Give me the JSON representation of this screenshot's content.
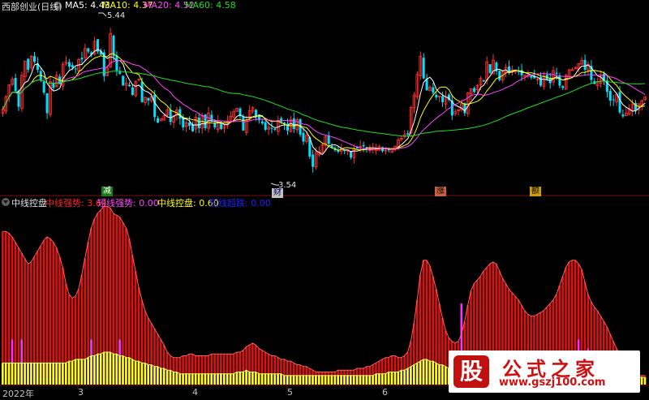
{
  "panel_top": {
    "title": "西部创业(日线)",
    "indicators": [
      {
        "label": "MA5: 4.43",
        "color": "#ffffff"
      },
      {
        "label": "MA10: 4.37",
        "color": "#ffff00"
      },
      {
        "label": "MA20: 4.52",
        "color": "#ff44ff"
      },
      {
        "label": "MA60: 4.58",
        "color": "#22dd22"
      }
    ],
    "high_label": "5.44",
    "low_label": "3.54",
    "markers": [
      {
        "text": "减",
        "bg": "#1a7a1a",
        "color": "#ffffff"
      },
      {
        "text": "财",
        "bg": "#c0c0c0",
        "color": "#000060"
      },
      {
        "text": "涨",
        "bg": "#c86040",
        "color": "#000000"
      },
      {
        "text": "额",
        "bg": "#d0a000",
        "color": "#000000"
      }
    ]
  },
  "panel_bottom": {
    "title": "中线控盘",
    "indicators": [
      {
        "label": "中线强势: 3.64",
        "color": "#ff2020"
      },
      {
        "label": "短线强势: 0.00",
        "color": "#ff44ff"
      },
      {
        "label": "中线控盘: 0.60",
        "color": "#ffff00"
      },
      {
        "label": "短线超跌: 0.00",
        "color": "#2020ff"
      }
    ]
  },
  "x_axis": {
    "labels": [
      "2022年",
      "3",
      "4",
      "5",
      "6"
    ]
  },
  "watermark": {
    "logo": "股",
    "name": "公式之家",
    "url": "www.gszj100.com"
  },
  "colors": {
    "up": "#ff3030",
    "down": "#00e0ff",
    "ma5": "#ffffff",
    "ma10": "#ffff00",
    "ma20": "#ff44ff",
    "ma60": "#22dd22",
    "bar_red": "#e01010",
    "bar_yellow": "#ffff20",
    "bar_magenta": "#ff30ff"
  },
  "chart_data": [
    {
      "type": "candlestick",
      "title": "西部创业(日线)",
      "series": [
        {
          "name": "MA5",
          "last": 4.43
        },
        {
          "name": "MA10",
          "last": 4.37
        },
        {
          "name": "MA20",
          "last": 4.52
        },
        {
          "name": "MA60",
          "last": 4.58
        }
      ],
      "close_approx": [
        4.36,
        4.52,
        4.67,
        4.74,
        4.59,
        4.39,
        4.79,
        4.97,
        4.86,
        5.03,
        4.96,
        4.86,
        4.73,
        4.57,
        4.31,
        4.71,
        4.63,
        4.79,
        4.68,
        4.93,
        4.96,
        4.9,
        4.89,
        4.87,
        4.99,
        4.99,
        5.13,
        5.09,
        5.05,
        5.22,
        5.09,
        5.05,
        4.78,
        4.88,
        5.32,
        5.03,
        4.85,
        4.81,
        4.66,
        4.69,
        4.65,
        4.54,
        4.71,
        4.74,
        4.45,
        4.51,
        4.47,
        4.52,
        4.26,
        4.19,
        4.24,
        4.28,
        4.35,
        4.2,
        4.28,
        4.35,
        4.24,
        4.13,
        4.19,
        4.15,
        4.08,
        4.26,
        4.12,
        4.28,
        4.12,
        4.31,
        4.21,
        4.13,
        4.21,
        4.11,
        4.17,
        4.21,
        4.27,
        4.33,
        4.37,
        4.27,
        4.09,
        4.22,
        4.34,
        4.38,
        4.27,
        4.22,
        4.18,
        4.1,
        4.13,
        4.12,
        4.1,
        4.22,
        4.2,
        4.17,
        4.09,
        4.23,
        4.11,
        4.23,
        4.04,
        3.95,
        4.03,
        3.76,
        3.63,
        3.81,
        3.82,
        3.91,
        4.01,
        3.92,
        3.87,
        3.84,
        3.82,
        3.87,
        3.83,
        3.85,
        3.75,
        3.86,
        3.86,
        3.89,
        3.89,
        3.86,
        3.86,
        3.86,
        3.87,
        3.89,
        3.83,
        3.84,
        3.84,
        3.86,
        3.89,
        3.97,
        3.99,
        4.04,
        4.04,
        4.38,
        4.54,
        4.8,
        5.03,
        4.75,
        4.6,
        4.64,
        4.57,
        4.51,
        4.53,
        4.45,
        4.52,
        4.48,
        4.28,
        4.33,
        4.35,
        4.43,
        4.31,
        4.57,
        4.62,
        4.58,
        4.66,
        4.75,
        4.71,
        4.96,
        4.82,
        4.98,
        4.84,
        4.73,
        4.85,
        4.89,
        4.82,
        4.86,
        4.84,
        4.84,
        4.79,
        4.79,
        4.79,
        4.76,
        4.75,
        4.74,
        4.66,
        4.78,
        4.74,
        4.69,
        4.85,
        4.81,
        4.66,
        4.63,
        4.79,
        4.86,
        4.86,
        4.89,
        4.94,
        4.98,
        4.86,
        4.93,
        4.73,
        4.68,
        4.71,
        4.79,
        4.72,
        4.58,
        4.47,
        4.48,
        4.55,
        4.32,
        4.27,
        4.31,
        4.36,
        4.42,
        4.34,
        4.43,
        4.47,
        4.52
      ],
      "price_range": [
        3.4,
        5.6
      ]
    },
    {
      "type": "bar",
      "title": "中线控盘",
      "series": [
        {
          "name": "中线强势",
          "last": 3.64
        },
        {
          "name": "短线强势",
          "last": 0.0
        },
        {
          "name": "中线控盘",
          "last": 0.6
        },
        {
          "name": "短线超跌",
          "last": 0.0
        }
      ],
      "red_values": [
        0.85,
        0.85,
        0.84,
        0.82,
        0.79,
        0.76,
        0.73,
        0.7,
        0.67,
        0.68,
        0.71,
        0.74,
        0.77,
        0.8,
        0.82,
        0.81,
        0.79,
        0.76,
        0.71,
        0.65,
        0.56,
        0.5,
        0.48,
        0.49,
        0.53,
        0.61,
        0.7,
        0.79,
        0.87,
        0.92,
        0.95,
        0.97,
        0.99,
        0.99,
        0.98,
        0.95,
        0.94,
        0.93,
        0.9,
        0.87,
        0.81,
        0.72,
        0.63,
        0.54,
        0.47,
        0.41,
        0.37,
        0.34,
        0.31,
        0.28,
        0.25,
        0.22,
        0.18,
        0.16,
        0.15,
        0.15,
        0.15,
        0.16,
        0.16,
        0.17,
        0.17,
        0.16,
        0.16,
        0.16,
        0.16,
        0.16,
        0.17,
        0.17,
        0.17,
        0.17,
        0.17,
        0.17,
        0.17,
        0.17,
        0.18,
        0.18,
        0.19,
        0.21,
        0.22,
        0.23,
        0.22,
        0.2,
        0.19,
        0.18,
        0.17,
        0.16,
        0.16,
        0.15,
        0.14,
        0.14,
        0.13,
        0.13,
        0.12,
        0.11,
        0.11,
        0.1,
        0.1,
        0.09,
        0.08,
        0.07,
        0.07,
        0.07,
        0.07,
        0.07,
        0.07,
        0.07,
        0.08,
        0.08,
        0.08,
        0.08,
        0.08,
        0.08,
        0.09,
        0.09,
        0.09,
        0.1,
        0.1,
        0.11,
        0.12,
        0.13,
        0.14,
        0.15,
        0.15,
        0.16,
        0.16,
        0.15,
        0.15,
        0.16,
        0.18,
        0.24,
        0.34,
        0.47,
        0.61,
        0.69,
        0.69,
        0.66,
        0.6,
        0.53,
        0.45,
        0.37,
        0.3,
        0.26,
        0.24,
        0.23,
        0.24,
        0.28,
        0.35,
        0.44,
        0.52,
        0.56,
        0.58,
        0.6,
        0.63,
        0.65,
        0.67,
        0.68,
        0.67,
        0.63,
        0.59,
        0.56,
        0.53,
        0.51,
        0.49,
        0.47,
        0.44,
        0.41,
        0.39,
        0.38,
        0.38,
        0.39,
        0.4,
        0.41,
        0.43,
        0.45,
        0.47,
        0.5,
        0.55,
        0.6,
        0.65,
        0.68,
        0.69,
        0.69,
        0.67,
        0.64,
        0.57,
        0.5,
        0.46,
        0.43,
        0.41,
        0.38,
        0.35,
        0.32,
        0.28,
        0.24,
        0.2,
        0.17,
        0.14,
        0.11,
        0.08,
        0.06,
        0.05,
        0.05,
        0.05,
        0.05,
        0.05
      ],
      "yellow_values": [
        0.12,
        0.12,
        0.12,
        0.12,
        0.12,
        0.12,
        0.12,
        0.12,
        0.12,
        0.12,
        0.12,
        0.12,
        0.12,
        0.12,
        0.12,
        0.12,
        0.12,
        0.12,
        0.12,
        0.12,
        0.12,
        0.13,
        0.13,
        0.14,
        0.14,
        0.14,
        0.14,
        0.15,
        0.16,
        0.16,
        0.17,
        0.17,
        0.18,
        0.18,
        0.18,
        0.17,
        0.17,
        0.16,
        0.16,
        0.15,
        0.15,
        0.14,
        0.13,
        0.13,
        0.12,
        0.12,
        0.11,
        0.11,
        0.1,
        0.1,
        0.09,
        0.09,
        0.08,
        0.08,
        0.07,
        0.07,
        0.06,
        0.06,
        0.06,
        0.06,
        0.06,
        0.06,
        0.06,
        0.06,
        0.06,
        0.06,
        0.06,
        0.06,
        0.06,
        0.06,
        0.06,
        0.06,
        0.06,
        0.06,
        0.07,
        0.07,
        0.07,
        0.08,
        0.07,
        0.07,
        0.07,
        0.06,
        0.06,
        0.06,
        0.06,
        0.06,
        0.06,
        0.06,
        0.06,
        0.05,
        0.05,
        0.05,
        0.05,
        0.05,
        0.05,
        0.05,
        0.05,
        0.05,
        0.05,
        0.05,
        0.05,
        0.05,
        0.05,
        0.05,
        0.05,
        0.05,
        0.05,
        0.05,
        0.05,
        0.05,
        0.05,
        0.05,
        0.05,
        0.05,
        0.05,
        0.05,
        0.05,
        0.05,
        0.06,
        0.06,
        0.06,
        0.06,
        0.07,
        0.07,
        0.07,
        0.07,
        0.08,
        0.08,
        0.09,
        0.1,
        0.11,
        0.12,
        0.13,
        0.14,
        0.14,
        0.13,
        0.13,
        0.12,
        0.11,
        0.11,
        0.1,
        0.09,
        0.08,
        0.08,
        0.08,
        0.08,
        0.08,
        0.09,
        0.09,
        0.1,
        0.11,
        0.12,
        0.13,
        0.14,
        0.14,
        0.15,
        0.15,
        0.15,
        0.15,
        0.14,
        0.14,
        0.13,
        0.13,
        0.13,
        0.12,
        0.12,
        0.12,
        0.12,
        0.12,
        0.12,
        0.12,
        0.12,
        0.12,
        0.12,
        0.13,
        0.14,
        0.15,
        0.16,
        0.16,
        0.16,
        0.16,
        0.15,
        0.15,
        0.14,
        0.13,
        0.13,
        0.12,
        0.11,
        0.1,
        0.09,
        0.08,
        0.07,
        0.06,
        0.05,
        0.05,
        0.04,
        0.04,
        0.04,
        0.04,
        0.04,
        0.04,
        0.04,
        0.04,
        0.04,
        0.04,
        0.04,
        0.04,
        0.04
      ],
      "magenta_spikes": [
        {
          "index": 3,
          "value": 0.25
        },
        {
          "index": 6,
          "value": 0.25
        },
        {
          "index": 28,
          "value": 0.25
        },
        {
          "index": 37,
          "value": 0.25
        },
        {
          "index": 145,
          "value": 0.45
        },
        {
          "index": 166,
          "value": 0.15
        },
        {
          "index": 182,
          "value": 0.25
        },
        {
          "index": 185,
          "value": 0.2
        }
      ],
      "y_range": [
        0,
        1
      ]
    }
  ]
}
